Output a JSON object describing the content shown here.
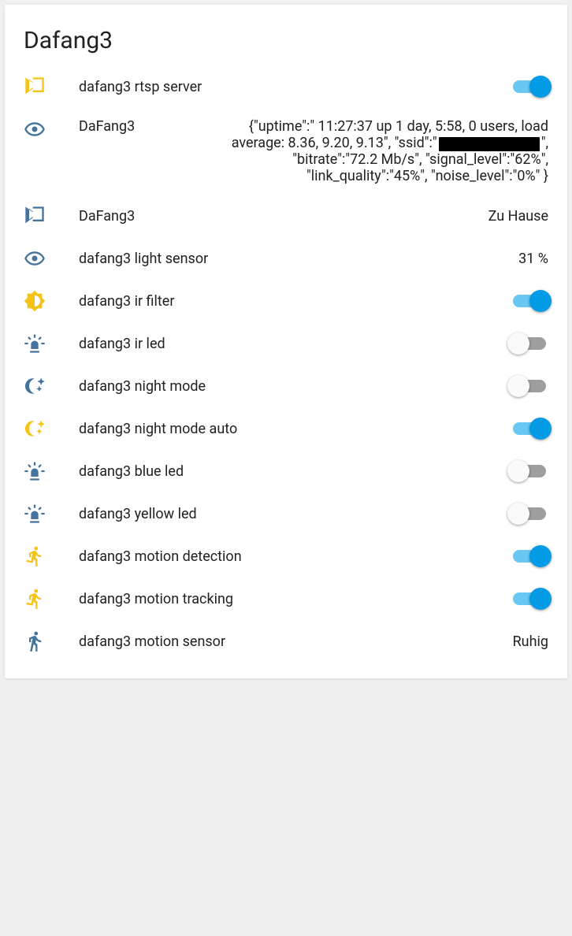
{
  "title": "Dafang3",
  "rows": [
    {
      "icon": "camera",
      "iconColor": "yellow",
      "label": "dafang3 rtsp server",
      "control": "toggle",
      "on": true
    },
    {
      "icon": "eye",
      "iconColor": "blue",
      "label": "DaFang3",
      "control": "json",
      "json": {
        "pre": "{\"uptime\":\" 11:27:37 up 1 day, 5:58, 0 users, load average: 8.36, 9.20, 9.13\", \"ssid\":\"",
        "post": "\", \"bitrate\":\"72.2 Mb/s\", \"signal_level\":\"62%\", \"link_quality\":\"45%\", \"noise_level\":\"0%\" }"
      }
    },
    {
      "icon": "camera",
      "iconColor": "blue",
      "label": "DaFang3",
      "control": "text",
      "value": "Zu Hause"
    },
    {
      "icon": "eye",
      "iconColor": "blue",
      "label": "dafang3 light sensor",
      "control": "text",
      "value": "31 %"
    },
    {
      "icon": "brightness",
      "iconColor": "yellow",
      "label": "dafang3 ir filter",
      "control": "toggle",
      "on": true
    },
    {
      "icon": "siren",
      "iconColor": "blue",
      "label": "dafang3 ir led",
      "control": "toggle",
      "on": false
    },
    {
      "icon": "moon",
      "iconColor": "blue",
      "label": "dafang3 night mode",
      "control": "toggle",
      "on": false
    },
    {
      "icon": "moon",
      "iconColor": "yellow",
      "label": "dafang3 night mode auto",
      "control": "toggle",
      "on": true
    },
    {
      "icon": "siren",
      "iconColor": "blue",
      "label": "dafang3 blue led",
      "control": "toggle",
      "on": false
    },
    {
      "icon": "siren",
      "iconColor": "blue",
      "label": "dafang3 yellow led",
      "control": "toggle",
      "on": false
    },
    {
      "icon": "run",
      "iconColor": "yellow",
      "label": "dafang3 motion detection",
      "control": "toggle",
      "on": true
    },
    {
      "icon": "run",
      "iconColor": "yellow",
      "label": "dafang3 motion tracking",
      "control": "toggle",
      "on": true
    },
    {
      "icon": "walk",
      "iconColor": "blue",
      "label": "dafang3 motion sensor",
      "control": "text",
      "value": "Ruhig"
    }
  ]
}
